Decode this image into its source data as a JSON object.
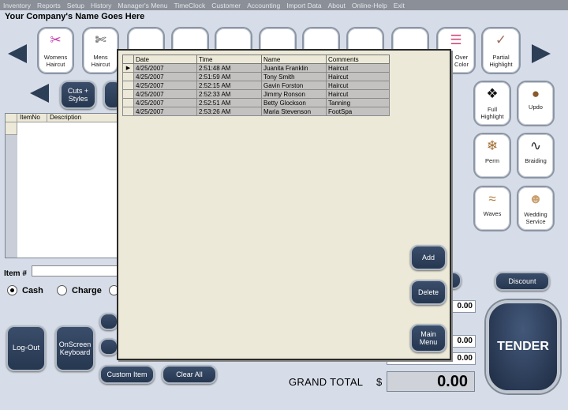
{
  "menubar": [
    "Inventory",
    "Reports",
    "Setup",
    "History",
    "Manager's Menu",
    "TimeClock",
    "Customer",
    "Accounting",
    "Import Data",
    "About",
    "Online-Help",
    "Exit"
  ],
  "company_name": "Your Company's Name Goes Here",
  "top_tiles": [
    {
      "label": "Womens\nHaircut",
      "icon": "scissors-comb-icon"
    },
    {
      "label": "Mens\nHaircut",
      "icon": "scissors-icon"
    },
    {
      "label": "Over\nColor",
      "icon": "color-swatch-icon"
    },
    {
      "label": "Partial\nHighlight",
      "icon": "brush-icon"
    }
  ],
  "side_tiles": [
    {
      "label": "Full\nHighlight",
      "icon": "hair-icon"
    },
    {
      "label": "Updo",
      "icon": "updo-icon"
    },
    {
      "label": "Perm",
      "icon": "perm-icon"
    },
    {
      "label": "Braiding",
      "icon": "braid-icon"
    },
    {
      "label": "Waves",
      "icon": "waves-icon"
    },
    {
      "label": "Wedding\nService",
      "icon": "bride-icon"
    }
  ],
  "category_button": "Cuts +\nStyles",
  "item_grid": {
    "col_itemno": "ItemNo",
    "col_description": "Description"
  },
  "item_number_label": "Item #",
  "payment": {
    "cash": "Cash",
    "charge": "Charge",
    "selected": "cash"
  },
  "buttons": {
    "logout": "Log-Out",
    "onscreen_keyboard": "OnScreen\nKeyboard",
    "custom_item": "Custom Item",
    "clear_all": "Clear All",
    "add": "Add",
    "delete": "Delete",
    "main_menu": "Main\nMenu",
    "discount": "Discount",
    "tender": "TENDER"
  },
  "popup": {
    "columns": [
      "Date",
      "Time",
      "Name",
      "Comments"
    ],
    "rows": [
      {
        "date": "4/25/2007",
        "time": "2:51:48 AM",
        "name": "Juanita Franklin",
        "comments": "Haircut"
      },
      {
        "date": "4/25/2007",
        "time": "2:51:59 AM",
        "name": "Tony Smith",
        "comments": "Haircut"
      },
      {
        "date": "4/25/2007",
        "time": "2:52:15 AM",
        "name": "Gavin Forston",
        "comments": "Haircut"
      },
      {
        "date": "4/25/2007",
        "time": "2:52:33 AM",
        "name": "Jimmy Ronson",
        "comments": "Haircut"
      },
      {
        "date": "4/25/2007",
        "time": "2:52:51 AM",
        "name": "Betty Glockson",
        "comments": "Tanning"
      },
      {
        "date": "4/25/2007",
        "time": "2:53:26 AM",
        "name": "Maria Stevenson",
        "comments": "FootSpa"
      }
    ]
  },
  "totals": {
    "value1": "0.00",
    "value2": "0.00",
    "value3": "0.00",
    "grand_total_label": "GRAND TOTAL",
    "currency": "$",
    "grand_total": "0.00"
  }
}
